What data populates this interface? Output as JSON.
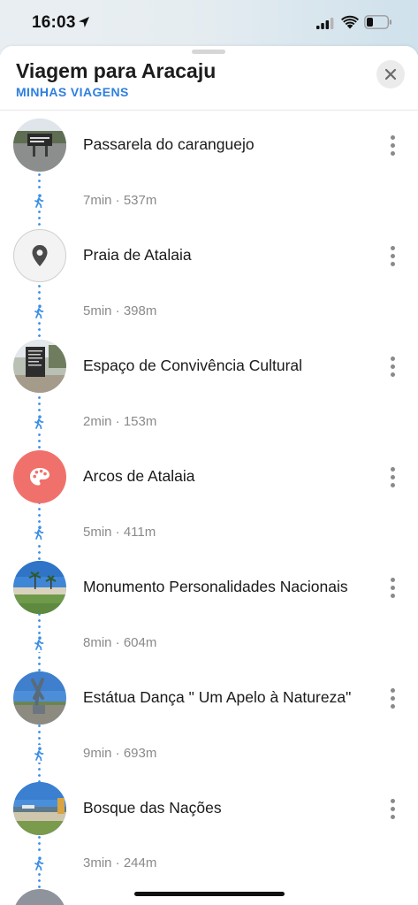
{
  "status_bar": {
    "time": "16:03",
    "icons": [
      "location-arrow-icon",
      "signal-icon",
      "wifi-icon",
      "battery-icon"
    ]
  },
  "sheet": {
    "title": "Viagem para Aracaju",
    "subtitle": "MINHAS VIAGENS",
    "close_icon": "close-icon"
  },
  "colors": {
    "accent": "#2e7fe0",
    "route_dots": "#3d8fe6",
    "art_category": "#f0716b",
    "text_primary": "#1a1a1a",
    "text_secondary": "#8a8a8a"
  },
  "stops": [
    {
      "name": "Passarela do caranguejo",
      "thumb": "photo-sign-icon",
      "walk": "7min · 537m"
    },
    {
      "name": "Praia de Atalaia",
      "thumb": "map-pin-icon",
      "walk": "5min · 398m"
    },
    {
      "name": "Espaço de Convivência Cultural",
      "thumb": "photo-board-icon",
      "walk": "2min · 153m"
    },
    {
      "name": "Arcos de Atalaia",
      "thumb": "palette-icon",
      "walk": "5min · 411m"
    },
    {
      "name": "Monumento Personalidades Nacionais",
      "thumb": "photo-beach-icon",
      "walk": "8min · 604m"
    },
    {
      "name": "Estátua Dança \" Um Apelo à Natureza\"",
      "thumb": "photo-statue-icon",
      "walk": "9min · 693m"
    },
    {
      "name": "Bosque das Nações",
      "thumb": "photo-park-icon",
      "walk": "3min · 244m"
    }
  ],
  "walk_icon": "walking-person-icon",
  "more_icon": "more-vertical-icon"
}
